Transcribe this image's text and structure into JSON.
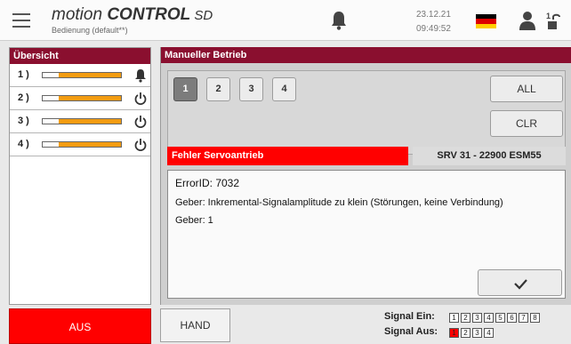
{
  "header": {
    "title_part1": "motion ",
    "title_part2": "CONTROL",
    "title_part3": " SD",
    "subtitle": "Bedienung (default**)",
    "date": "23.12.21",
    "time": "09:49:52",
    "flag_colors": [
      "#000000",
      "#dd0000",
      "#ffce00"
    ]
  },
  "overview": {
    "title": "Übersicht",
    "rows": [
      {
        "label": "1 )",
        "icon": "bell-icon"
      },
      {
        "label": "2 )",
        "icon": "power-icon"
      },
      {
        "label": "3 )",
        "icon": "power-icon"
      },
      {
        "label": "4 )",
        "icon": "power-icon"
      }
    ]
  },
  "manual": {
    "title": "Manueller Betrieb",
    "numbers": [
      "1",
      "2",
      "3",
      "4"
    ],
    "active_number": "1",
    "all_label": "ALL",
    "clr_label": "CLR",
    "error_label": "Fehler Servoantrieb",
    "device": "SRV 31 - 22900 ESM55",
    "error_id": "ErrorID: 7032",
    "line1": "Geber: Inkremental-Signalamplitude zu klein (Störungen, keine Verbindung)",
    "line2": "Geber: 1"
  },
  "footer": {
    "aus_label": "AUS",
    "hand_label": "HAND",
    "signal_on_label": "Signal Ein:",
    "signal_off_label": "Signal Aus:",
    "signal_on_boxes": [
      "1",
      "2",
      "3",
      "4",
      "5",
      "6",
      "7",
      "8"
    ],
    "signal_off_boxes": [
      "1",
      "2",
      "3",
      "4"
    ],
    "signal_off_active": "1"
  },
  "colors": {
    "accent": "#8a0f2f",
    "error": "#ff0000",
    "bar": "#f39c12"
  }
}
